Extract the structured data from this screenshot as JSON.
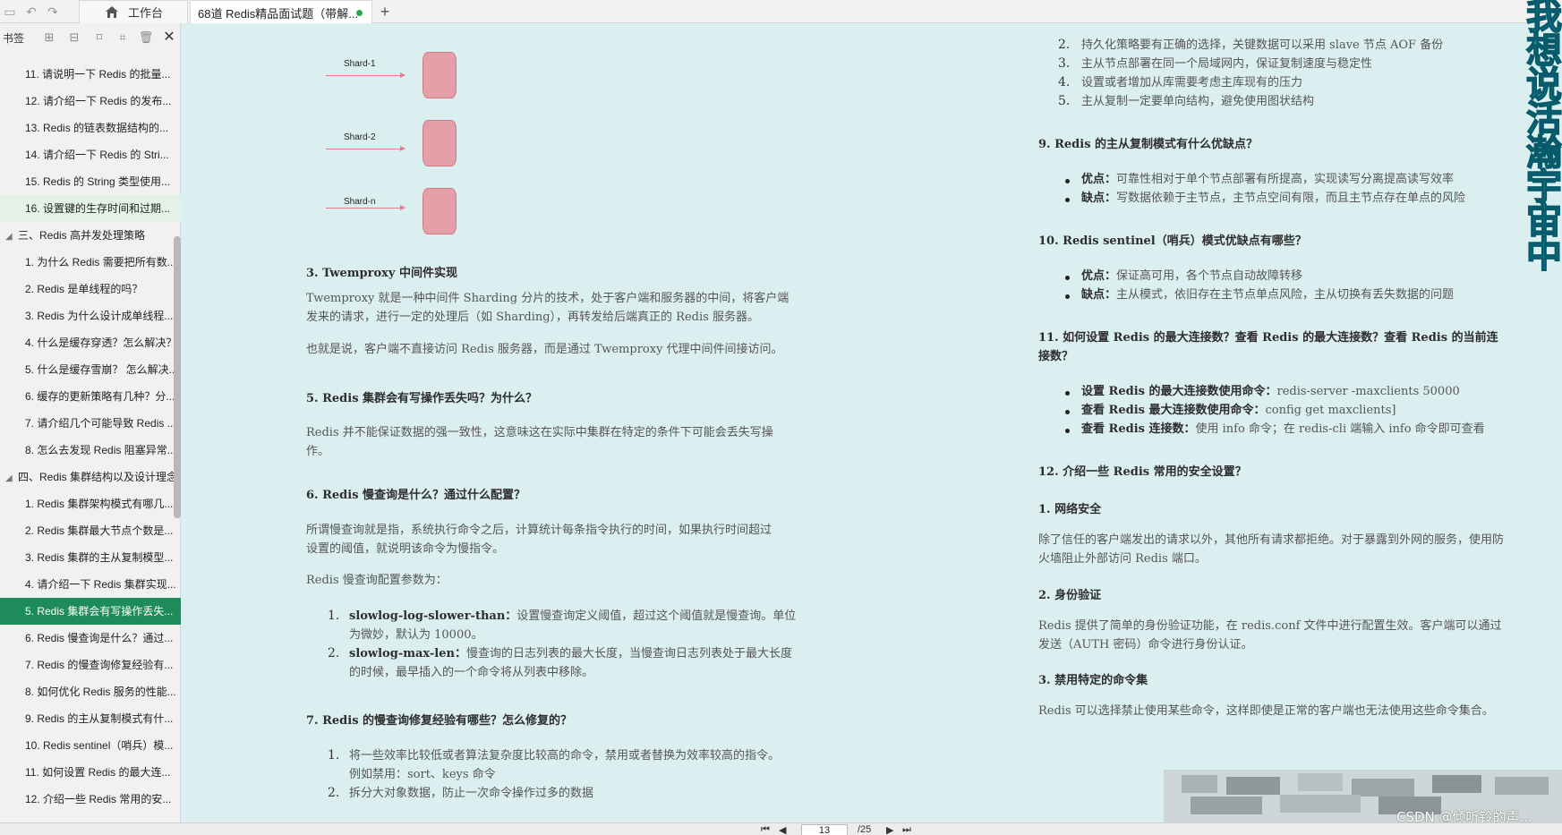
{
  "toolbar": {
    "home_tab_label": "工作台",
    "doc_tab_label": "68道 Redis精品面试题（带解...",
    "add_tab_symbol": "+"
  },
  "sidebar": {
    "title": "书签",
    "items": [
      {
        "label": "11. 请说明一下 Redis 的批量...",
        "type": "item"
      },
      {
        "label": "12. 请介绍一下 Redis 的发布...",
        "type": "item"
      },
      {
        "label": "13. Redis 的链表数据结构的...",
        "type": "item"
      },
      {
        "label": "14. 请介绍一下 Redis 的 Stri...",
        "type": "item"
      },
      {
        "label": "15. Redis 的 String 类型使用...",
        "type": "item"
      },
      {
        "label": "16. 设置键的生存时间和过期...",
        "type": "item"
      },
      {
        "label": "三、Redis 高并发处理策略",
        "type": "section"
      },
      {
        "label": "1. 为什么 Redis 需要把所有数...",
        "type": "item"
      },
      {
        "label": "2. Redis 是单线程的吗？",
        "type": "item"
      },
      {
        "label": "3. Redis 为什么设计成单线程...",
        "type": "item"
      },
      {
        "label": "4. 什么是缓存穿透？怎么解决？",
        "type": "item"
      },
      {
        "label": "5. 什么是缓存雪崩？ 怎么解决...",
        "type": "item"
      },
      {
        "label": "6. 缓存的更新策略有几种？分...",
        "type": "item"
      },
      {
        "label": "7. 请介绍几个可能导致 Redis ...",
        "type": "item"
      },
      {
        "label": "8. 怎么去发现 Redis 阻塞异常...",
        "type": "item"
      },
      {
        "label": "四、Redis 集群结构以及设计理念",
        "type": "section"
      },
      {
        "label": "1. Redis 集群架构模式有哪几...",
        "type": "item"
      },
      {
        "label": "2. Redis 集群最大节点个数是...",
        "type": "item"
      },
      {
        "label": "3. Redis 集群的主从复制模型...",
        "type": "item"
      },
      {
        "label": "4. 请介绍一下 Redis 集群实现...",
        "type": "item"
      },
      {
        "label": "5. Redis 集群会有写操作丢失...",
        "type": "item"
      },
      {
        "label": "6. Redis 慢查询是什么？通过...",
        "type": "item"
      },
      {
        "label": "7. Redis 的慢查询修复经验有...",
        "type": "item"
      },
      {
        "label": "8. 如何优化 Redis 服务的性能...",
        "type": "item"
      },
      {
        "label": "9. Redis 的主从复制模式有什...",
        "type": "item"
      },
      {
        "label": "10. Redis sentinel（哨兵）模...",
        "type": "item"
      },
      {
        "label": "11. 如何设置 Redis 的最大连...",
        "type": "item"
      },
      {
        "label": "12. 介绍一些 Redis 常用的安...",
        "type": "item"
      }
    ]
  },
  "diagram": {
    "shards": [
      "Shard-1",
      "Shard-2",
      "Shard-n"
    ]
  },
  "left_page": {
    "h_twemproxy": "3. Twemproxy 中间件实现",
    "p_twemproxy_1a": "Twemproxy 就是一种中间件 Sharding 分片的技术，处于客户端和服务器的中间，将客户端",
    "p_twemproxy_1b": "发来的请求，进行一定的处理后（如 Sharding），再转发给后端真正的 Redis 服务器。",
    "p_twemproxy_2": "也就是说，客户端不直接访问 Redis 服务器，而是通过 Twemproxy 代理中间件间接访问。",
    "h5": "5. Redis 集群会有写操作丢失吗？为什么？",
    "p5a": "Redis 并不能保证数据的强一致性，这意味这在实际中集群在特定的条件下可能会丢失写操",
    "p5b": "作。",
    "h6": "6. Redis 慢查询是什么？通过什么配置？",
    "p6a": "所谓慢查询就是指，系统执行命令之后，计算统计每条指令执行的时间，如果执行时间超过",
    "p6b": "设置的阈值，就说明该命令为慢指令。",
    "p6c": "Redis 慢查询配置参数为：",
    "ol6": [
      {
        "n": "1.",
        "b": "slowlog-log-slower-than：",
        "t": "设置慢查询定义阈值，超过这个阈值就是慢查询。单位",
        "t2": "为微妙，默认为 10000。"
      },
      {
        "n": "2.",
        "b": "slowlog-max-len：",
        "t": "慢查询的日志列表的最大长度，当慢查询日志列表处于最大长度",
        "t2": "的时候，最早插入的一个命令将从列表中移除。"
      }
    ],
    "h7": "7. Redis 的慢查询修复经验有哪些？怎么修复的？",
    "ol7": [
      {
        "n": "1.",
        "t": "将一些效率比较低或者算法复杂度比较高的命令，禁用或者替换为效率较高的指令。",
        "t2": "例如禁用：sort、keys 命令"
      },
      {
        "n": "2.",
        "t": "拆分大对象数据，防止一次命令操作过多的数据"
      }
    ]
  },
  "right_page": {
    "ol_top": [
      {
        "n": "2.",
        "t": "持久化策略要有正确的选择，关键数据可以采用 slave 节点 AOF 备份"
      },
      {
        "n": "3.",
        "t": "主从节点部署在同一个局域网内，保证复制速度与稳定性"
      },
      {
        "n": "4.",
        "t": "设置或者增加从库需要考虑主库现有的压力"
      },
      {
        "n": "5.",
        "t": "主从复制一定要单向结构，避免使用图状结构"
      }
    ],
    "h9": "9. Redis 的主从复制模式有什么优缺点？",
    "ul9": [
      {
        "b": "优点：",
        "t": "可靠性相对于单个节点部署有所提高，实现读写分离提高读写效率"
      },
      {
        "b": "缺点：",
        "t": "写数据依赖于主节点，主节点空间有限，而且主节点存在单点的风险"
      }
    ],
    "h10": "10. Redis sentinel（哨兵）模式优缺点有哪些？",
    "ul10": [
      {
        "b": "优点：",
        "t": "保证高可用，各个节点自动故障转移"
      },
      {
        "b": "缺点：",
        "t": "主从模式，依旧存在主节点单点风险，主从切换有丢失数据的问题"
      }
    ],
    "h11a": "11. 如何设置 Redis 的最大连接数？查看 Redis 的最大连接数？查看 Redis 的当前连",
    "h11b": "接数？",
    "ul11": [
      {
        "b": "设置 Redis 的最大连接数使用命令：",
        "t": "redis-server -maxclients 50000"
      },
      {
        "b": "查看 Redis 最大连接数使用命令：",
        "t": "config get maxclients]"
      },
      {
        "b": "查看 Redis 连接数：",
        "t": "使用 info 命令；在 redis-cli 端输入 info 命令即可查看"
      }
    ],
    "h12": "12. 介绍一些 Redis 常用的安全设置？",
    "s1": "1. 网络安全",
    "p_s1a": "除了信任的客户端发出的请求以外，其他所有请求都拒绝。对于暴露到外网的服务，使用防",
    "p_s1b": "火墙阻止外部访问 Redis 端口。",
    "s2": "2. 身份验证",
    "p_s2a": "Redis 提供了简单的身份验证功能，在 redis.conf 文件中进行配置生效。客户端可以通过",
    "p_s2b": "发送（AUTH 密码）命令进行身份认证。",
    "s3": "3. 禁用特定的命令集",
    "p_s3": "Redis 可以选择禁止使用某些命令，这样即使是正常的客户端也无法使用这些命令集合。"
  },
  "watermark": {
    "vertical_logo": [
      "我",
      "想",
      "说",
      "活",
      "瀚",
      "宇",
      "宙",
      "中"
    ],
    "csdn": "CSDN @倾听铃的声..."
  },
  "pager": {
    "current": "13",
    "total": "/25"
  },
  "colors": {
    "accent": "#1e8c5a",
    "doc_bg": "#dceff0",
    "shard_fill": "#e4a0a8"
  }
}
